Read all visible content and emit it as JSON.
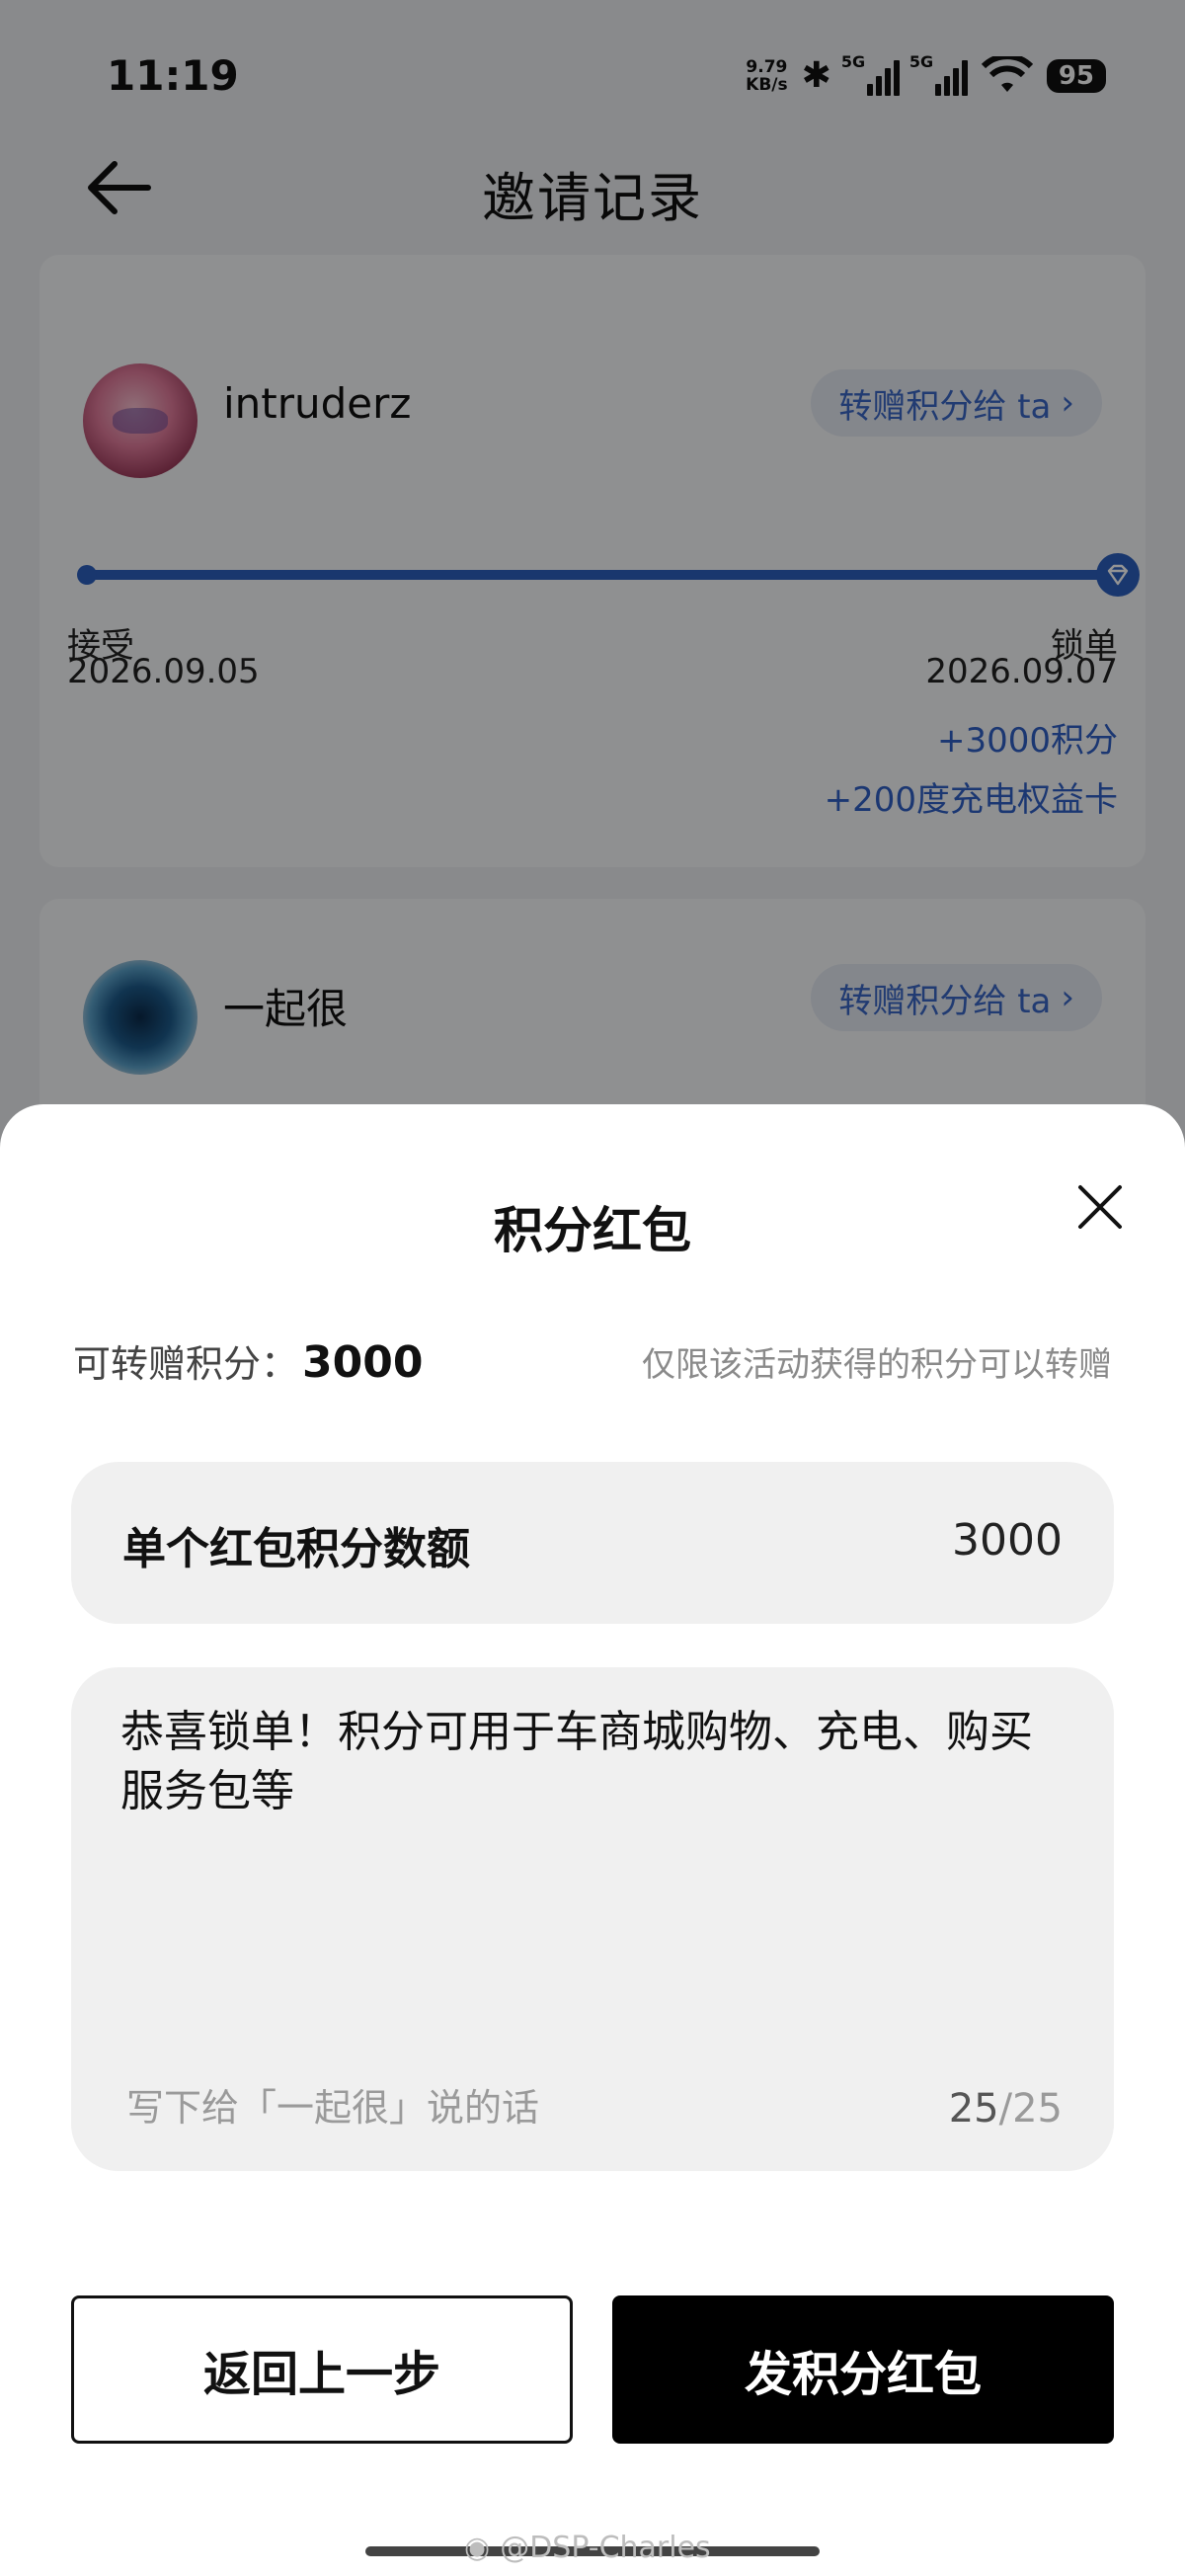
{
  "status_bar": {
    "time": "11:19",
    "net_speed_value": "9.79",
    "net_speed_unit": "KB/s",
    "sim1_label": "5G",
    "sim2_label": "5G",
    "battery": "95"
  },
  "header": {
    "title": "邀请记录"
  },
  "records": [
    {
      "username": "intruderz",
      "gift_button": "转赠积分给 ta",
      "step_start_label": "接受",
      "step_start_date": "2026.09.05",
      "step_end_label": "锁单",
      "step_end_date": "2026.09.07",
      "rewards": [
        "+3000积分",
        "+200度充电权益卡"
      ]
    },
    {
      "username": "一起很",
      "gift_button": "转赠积分给 ta"
    }
  ],
  "sheet": {
    "title": "积分红包",
    "transferable_label": "可转赠积分：",
    "transferable_value": "3000",
    "note": "仅限该活动获得的积分可以转赠",
    "amount_label": "单个红包积分数额",
    "amount_value": "3000",
    "message_text": "恭喜锁单！积分可用于车商城购物、充电、购买服务包等",
    "message_placeholder": "写下给「一起很」说的话",
    "char_count": "25",
    "char_max": "/25",
    "back_button": "返回上一步",
    "send_button": "发积分红包"
  },
  "watermark": "@DSP-Charles",
  "colors": {
    "accent_blue": "#2c5fbd",
    "reward_blue": "#2f5fc4",
    "primary_button": "#000000"
  }
}
